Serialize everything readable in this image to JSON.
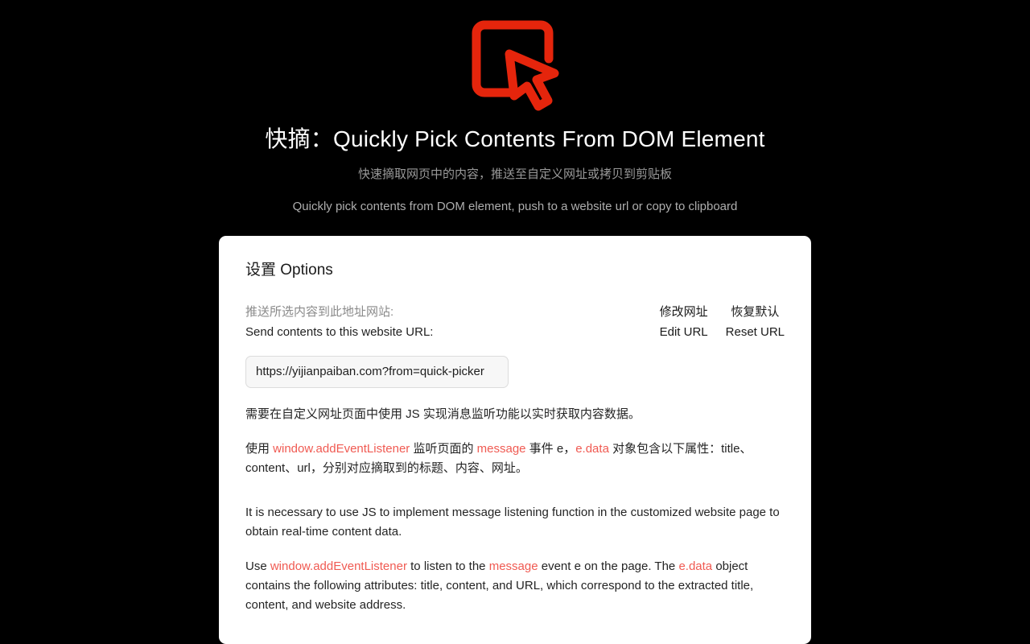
{
  "page": {
    "background_color": "#000000",
    "logo_color": "#e5250c",
    "code_color": "#f05a52"
  },
  "header": {
    "logo_icon": "dom-element-picker-cursor-icon",
    "title": "快摘：Quickly Pick Contents From DOM Element",
    "subtitle_cn": "快速摘取网页中的内容，推送至自定义网址或拷贝到剪贴板",
    "subtitle_en": "Quickly pick contents from DOM element, push to a website url or copy to clipboard"
  },
  "card": {
    "title": "设置 Options",
    "field": {
      "label_cn": "推送所选内容到此地址网站:",
      "label_en": "Send contents to this website URL:",
      "input_value": "https://yijianpaiban.com?from=quick-picker",
      "input_placeholder": "https://yijianpaiban.com?from=quick-picker"
    },
    "actions": {
      "edit": {
        "cn": "修改网址",
        "en": "Edit URL"
      },
      "reset": {
        "cn": "恢复默认",
        "en": "Reset URL"
      }
    },
    "paragraphs": {
      "cn_1": "需要在自定义网址页面中使用 JS 实现消息监听功能以实时获取内容数据。",
      "cn_2_part1": "使用 ",
      "cn_2_code1": "window.addEventListener",
      "cn_2_part2": " 监听页面的 ",
      "cn_2_code2": "message",
      "cn_2_part3": " 事件 e，",
      "cn_2_code3": "e.data",
      "cn_2_part4": " 对象包含以下属性：title、content、url，分别对应摘取到的标题、内容、网址。",
      "en_1": "It is necessary to use JS to implement message listening function in the customized website page to obtain real-time content data.",
      "en_2_part1": "Use ",
      "en_2_code1": "window.addEventListener",
      "en_2_part2": " to listen to the ",
      "en_2_code2": "message",
      "en_2_part3": " event e on the page. The ",
      "en_2_code3": "e.data",
      "en_2_part4": " object contains the following attributes: title, content, and URL, which correspond to the extracted title, content, and website address."
    }
  }
}
